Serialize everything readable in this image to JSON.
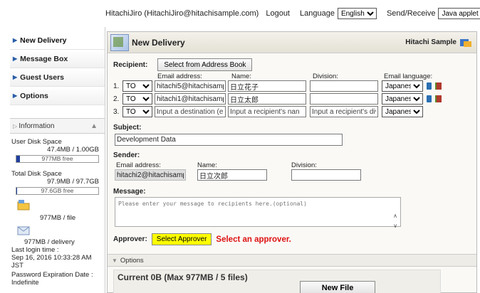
{
  "header": {
    "user": "HitachiJiro (HitachiJiro@hitachisample.com)",
    "logout": "Logout",
    "language_label": "Language",
    "language_value": "English",
    "send_receive_label": "Send/Receive",
    "send_receive_value": "Java applet"
  },
  "sidebar": {
    "items": [
      {
        "label": "New Delivery"
      },
      {
        "label": "Message Box"
      },
      {
        "label": "Guest Users"
      },
      {
        "label": "Options"
      }
    ],
    "info_label": "Information",
    "user_disk_label": "User Disk Space",
    "user_disk_value": "47.4MB / 1.00GB",
    "user_disk_free": "977MB free",
    "user_disk_fraction": 0.047,
    "total_disk_label": "Total Disk Space",
    "total_disk_value": "97.9MB / 97.7GB",
    "total_disk_free": "97.6GB free",
    "total_disk_fraction": 0.001,
    "per_file": "977MB / file",
    "per_delivery": "977MB / delivery",
    "last_login_label": "Last login time :",
    "last_login_value": "Sep 16, 2016 10:33:28 AM JST",
    "pwd_exp_label": "Password Expiration Date :",
    "pwd_exp_value": "Indefinite"
  },
  "main": {
    "title": "New Delivery",
    "brand": "Hitachi Sample",
    "recipient_label": "Recipient:",
    "address_book_button": "Select from Address Book",
    "col_email": "Email address:",
    "col_name": "Name:",
    "col_division": "Division:",
    "col_lang": "Email language:",
    "recipients": [
      {
        "num": "1.",
        "type": "TO",
        "email": "hitachi5@hitachisamp",
        "name": "日立花子",
        "division": "",
        "lang": "Japanese"
      },
      {
        "num": "2.",
        "type": "TO",
        "email": "hitachi1@hitachisamp",
        "name": "日立太郎",
        "division": "",
        "lang": "Japanese"
      },
      {
        "num": "3.",
        "type": "TO",
        "email_placeholder": "Input a destination (er",
        "name_placeholder": "Input a recipient's nan",
        "division_placeholder": "Input a recipient's divi:",
        "lang": "Japanese"
      }
    ],
    "subject_label": "Subject:",
    "subject_value": "Development Data",
    "sender_label": "Sender:",
    "sender_email_label": "Email address:",
    "sender_email": "hitachi2@hitachisamp",
    "sender_name_label": "Name:",
    "sender_name": "日立次郎",
    "sender_division_label": "Division:",
    "message_label": "Message:",
    "message_placeholder": "Please enter your message to recipients here.(optional)",
    "approver_label": "Approver:",
    "approver_button": "Select Approver",
    "approver_warning": "Select an approver.",
    "options_label": "Options",
    "current_files": "Current 0B (Max  977MB / 5 files)",
    "new_file_button": "New File"
  }
}
